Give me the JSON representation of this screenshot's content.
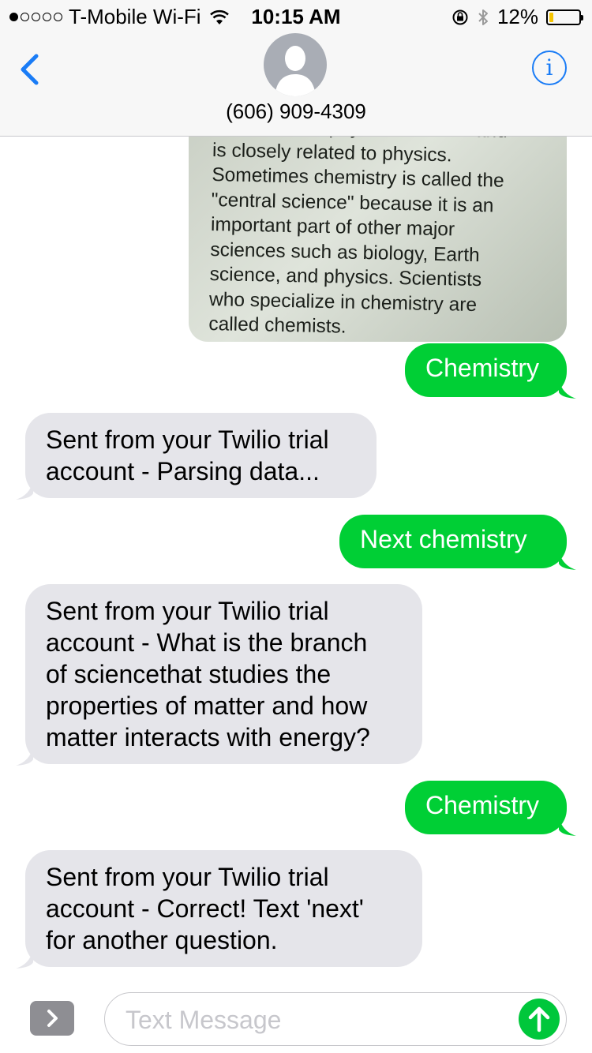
{
  "status_bar": {
    "carrier": "T-Mobile Wi-Fi",
    "time": "10:15 AM",
    "battery": "12%",
    "battery_level": 0.12
  },
  "header": {
    "contact": "(606) 909-4309",
    "back_icon": "chevron-left-icon",
    "info_icon": "info-icon",
    "accent_color": "#1a7cf6"
  },
  "image_message": {
    "lines": [
      "considered a physical science and",
      "is closely related to physics.",
      "Sometimes chemistry is called the",
      "\"central science\" because it is an",
      "important part of other major",
      "sciences such as biology, Earth",
      "science, and physics. Scientists",
      "who specialize in chemistry are",
      "called chemists."
    ]
  },
  "messages": [
    {
      "direction": "outgoing",
      "text": "Chemistry"
    },
    {
      "direction": "incoming",
      "lines": [
        "Sent from your Twilio trial",
        "account - Parsing data..."
      ]
    },
    {
      "direction": "outgoing",
      "text": "Next chemistry"
    },
    {
      "direction": "incoming",
      "lines": [
        "Sent from your Twilio trial",
        "account - What is the branch",
        "of sciencethat studies the",
        "properties of matter and how",
        "matter interacts with energy?"
      ]
    },
    {
      "direction": "outgoing",
      "text": "Chemistry"
    },
    {
      "direction": "incoming",
      "lines": [
        "Sent from your Twilio trial",
        "account - Correct! Text 'next'",
        "for another question."
      ]
    }
  ],
  "compose": {
    "placeholder": "Text Message",
    "value": "",
    "apps_icon": "chevron-right-icon",
    "send_icon": "arrow-up-icon"
  },
  "colors": {
    "outgoing_bubble": "#00cf35",
    "incoming_bubble": "#e5e5ea"
  }
}
